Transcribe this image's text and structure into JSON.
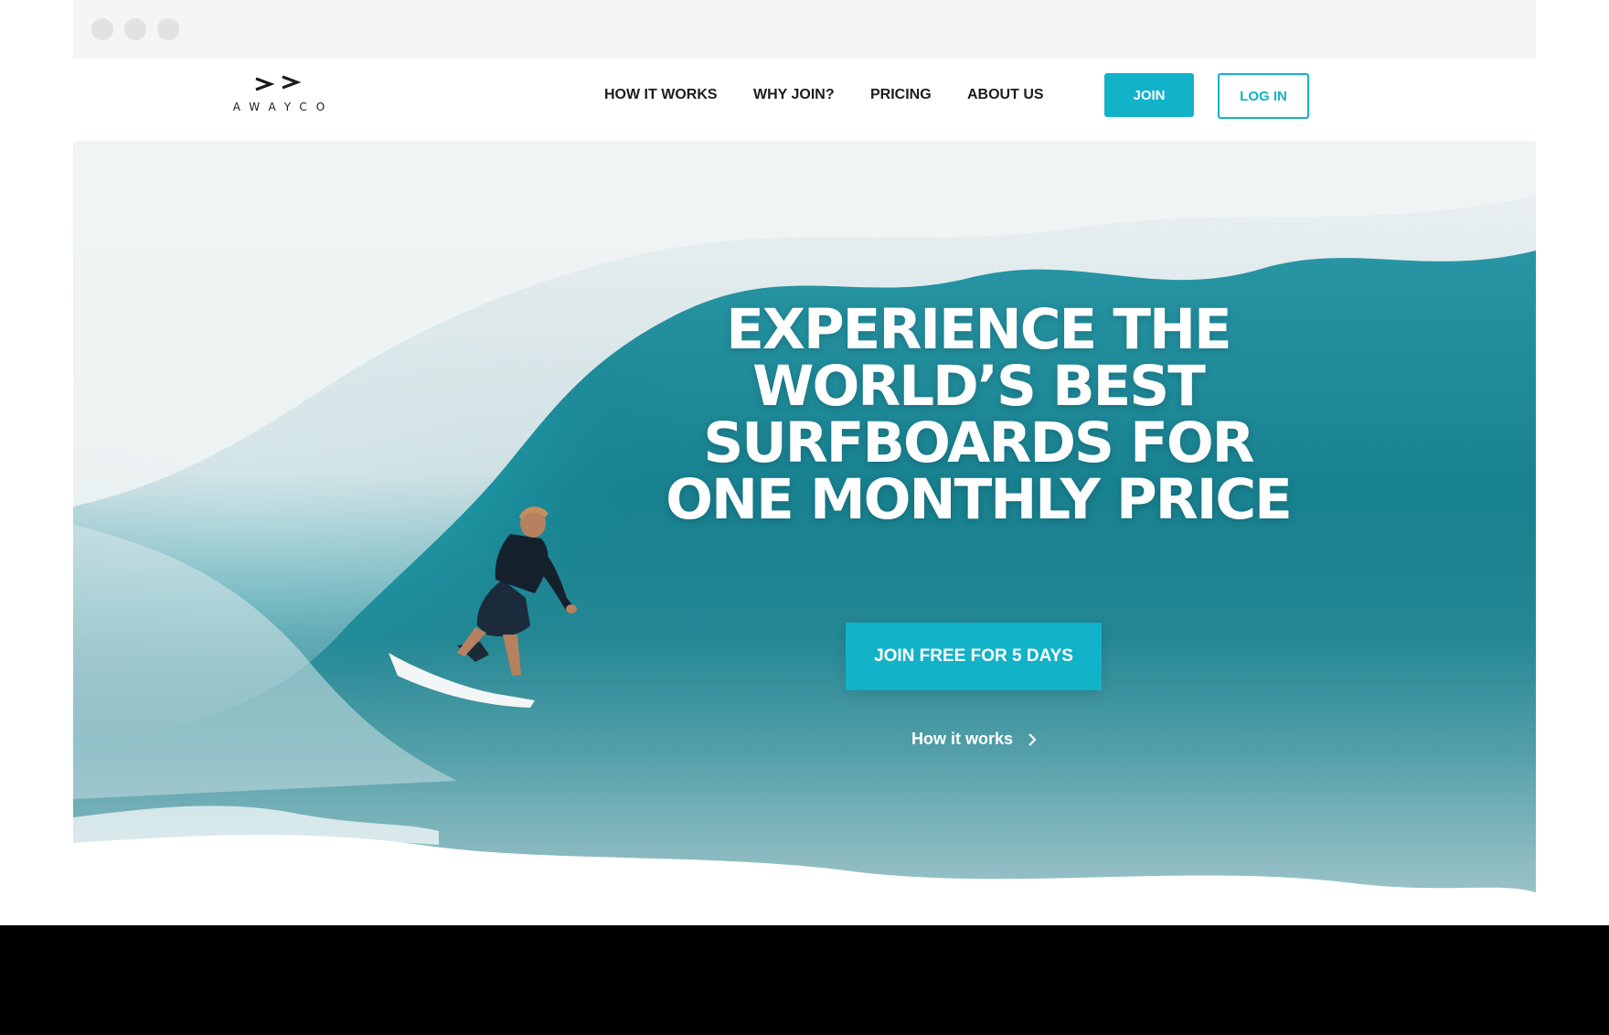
{
  "logo": {
    "wordmark": "AWAYCO",
    "icon": "double-chevron-logo-icon"
  },
  "nav": {
    "links": [
      "HOW IT WORKS",
      "WHY JOIN?",
      "PRICING",
      "ABOUT US"
    ],
    "join_label": "JOIN",
    "login_label": "LOG IN"
  },
  "hero": {
    "headline": [
      "EXPERIENCE THE",
      "WORLD’S BEST",
      "SURFBOARDS FOR",
      "ONE MONTHLY PRICE"
    ],
    "cta_label": "JOIN FREE FOR 5 DAYS",
    "secondary_link": "How it works",
    "secondary_icon": "chevron-right-icon"
  },
  "colors": {
    "accent": "#12b2c9",
    "nav_text": "#1c1c1c",
    "hero_text": "#ffffff",
    "wave_deep": "#0f7f8e",
    "wave_light": "#5cc6d2",
    "foam": "#e9eef0"
  }
}
